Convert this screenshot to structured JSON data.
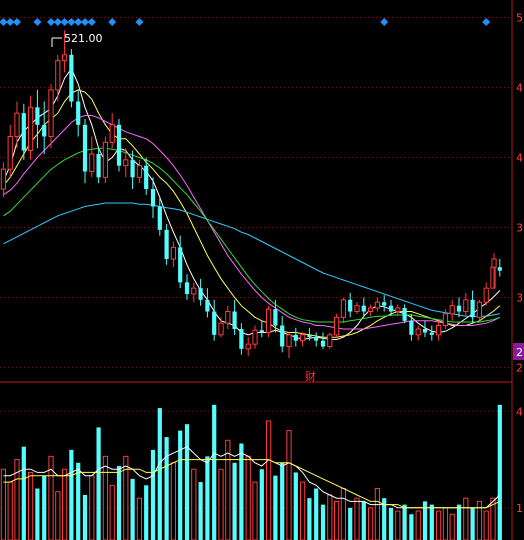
{
  "colors": {
    "background": "#000000",
    "up": "#ff3b3b",
    "down": "#54fcfc",
    "grid": "#7a1010",
    "axis": "#b01818",
    "ma5": "#ffffff",
    "ma10": "#ffff55",
    "ma20": "#ff66ff",
    "ma30": "#33dd33",
    "ma60": "#33ccff",
    "marker": "#1e90ff",
    "peak_label": "#ffffff",
    "event_badge": "#ff3030",
    "side_tag": "#8a1b9c"
  },
  "price_axis_labels": [
    "5",
    "4",
    "4",
    "3",
    "3",
    "2"
  ],
  "volume_axis_labels": [
    "4",
    "1"
  ],
  "peak_label": "521.00",
  "event_badge_text": "财",
  "side_tag_text": "2",
  "chart_data": [
    {
      "type": "candlestick",
      "title": "",
      "ylim": [
        223,
        535
      ],
      "ytick_positions": [
        532,
        472,
        412,
        352,
        292,
        232
      ],
      "ytick_labels": [
        "5",
        "4",
        "4",
        "3",
        "3",
        "2"
      ],
      "highest": 521.0,
      "ohlc": [
        [
          385,
          408,
          378,
          402
        ],
        [
          402,
          440,
          395,
          430
        ],
        [
          430,
          460,
          420,
          450
        ],
        [
          450,
          458,
          410,
          418
        ],
        [
          418,
          465,
          410,
          455
        ],
        [
          455,
          470,
          420,
          440
        ],
        [
          440,
          460,
          415,
          430
        ],
        [
          430,
          475,
          420,
          470
        ],
        [
          470,
          500,
          460,
          495
        ],
        [
          495,
          521,
          485,
          500
        ],
        [
          500,
          505,
          455,
          460
        ],
        [
          460,
          470,
          430,
          440
        ],
        [
          440,
          445,
          390,
          400
        ],
        [
          400,
          430,
          395,
          415
        ],
        [
          415,
          420,
          390,
          395
        ],
        [
          395,
          430,
          390,
          425
        ],
        [
          425,
          450,
          420,
          440
        ],
        [
          440,
          445,
          400,
          405
        ],
        [
          405,
          420,
          395,
          410
        ],
        [
          410,
          418,
          385,
          395
        ],
        [
          395,
          410,
          390,
          405
        ],
        [
          405,
          412,
          380,
          385
        ],
        [
          385,
          395,
          360,
          370
        ],
        [
          370,
          378,
          345,
          350
        ],
        [
          350,
          355,
          320,
          325
        ],
        [
          325,
          340,
          318,
          335
        ],
        [
          335,
          345,
          300,
          305
        ],
        [
          305,
          312,
          290,
          295
        ],
        [
          295,
          305,
          288,
          300
        ],
        [
          300,
          308,
          285,
          290
        ],
        [
          290,
          300,
          275,
          280
        ],
        [
          280,
          290,
          255,
          260
        ],
        [
          260,
          275,
          258,
          270
        ],
        [
          270,
          285,
          265,
          280
        ],
        [
          280,
          290,
          260,
          265
        ],
        [
          265,
          270,
          243,
          248
        ],
        [
          248,
          258,
          242,
          252
        ],
        [
          252,
          268,
          248,
          264
        ],
        [
          264,
          272,
          258,
          262
        ],
        [
          262,
          285,
          258,
          282
        ],
        [
          282,
          290,
          262,
          268
        ],
        [
          268,
          276,
          245,
          250
        ],
        [
          250,
          262,
          240,
          260
        ],
        [
          260,
          266,
          250,
          255
        ],
        [
          255,
          262,
          250,
          260
        ],
        [
          260,
          266,
          255,
          258
        ],
        [
          258,
          262,
          250,
          255
        ],
        [
          255,
          262,
          248,
          250
        ],
        [
          250,
          262,
          248,
          260
        ],
        [
          260,
          278,
          258,
          275
        ],
        [
          275,
          292,
          270,
          290
        ],
        [
          290,
          296,
          275,
          280
        ],
        [
          280,
          288,
          278,
          285
        ],
        [
          285,
          292,
          275,
          280
        ],
        [
          280,
          286,
          276,
          283
        ],
        [
          283,
          292,
          280,
          288
        ],
        [
          288,
          294,
          280,
          285
        ],
        [
          285,
          290,
          276,
          280
        ],
        [
          280,
          286,
          276,
          283
        ],
        [
          283,
          286,
          270,
          272
        ],
        [
          272,
          278,
          255,
          260
        ],
        [
          260,
          268,
          255,
          265
        ],
        [
          265,
          272,
          258,
          262
        ],
        [
          262,
          268,
          255,
          260
        ],
        [
          260,
          272,
          255,
          268
        ],
        [
          268,
          282,
          265,
          278
        ],
        [
          278,
          290,
          272,
          285
        ],
        [
          285,
          292,
          275,
          280
        ],
        [
          280,
          296,
          276,
          290
        ],
        [
          290,
          298,
          270,
          275
        ],
        [
          275,
          290,
          272,
          288
        ],
        [
          288,
          305,
          285,
          300
        ],
        [
          300,
          322,
          300,
          318
        ],
        [
          318,
          325,
          310,
          315
        ]
      ],
      "series": [
        {
          "name": "MA5",
          "values": [
            392,
            405,
            425,
            435,
            440,
            446,
            450,
            454,
            465,
            480,
            488,
            475,
            455,
            440,
            420,
            408,
            412,
            420,
            418,
            410,
            405,
            400,
            392,
            378,
            362,
            348,
            335,
            320,
            308,
            298,
            290,
            280,
            272,
            270,
            268,
            262,
            260,
            262,
            262,
            262,
            264,
            262,
            260,
            258,
            256,
            257,
            258,
            257,
            256,
            256,
            258,
            262,
            268,
            276,
            282,
            285,
            284,
            282,
            280,
            278,
            275,
            270,
            266,
            263,
            262,
            263,
            266,
            270,
            274,
            278,
            283,
            287,
            292,
            298
          ]
        },
        {
          "name": "MA10",
          "values": [
            388,
            395,
            405,
            415,
            425,
            432,
            440,
            445,
            450,
            460,
            467,
            470,
            468,
            462,
            450,
            440,
            432,
            428,
            428,
            422,
            415,
            408,
            402,
            395,
            390,
            383,
            374,
            364,
            352,
            340,
            328,
            318,
            308,
            300,
            292,
            285,
            280,
            275,
            272,
            270,
            266,
            263,
            262,
            262,
            261,
            260,
            259,
            258,
            258,
            258,
            259,
            260,
            262,
            265,
            268,
            272,
            275,
            278,
            280,
            280,
            280,
            278,
            276,
            274,
            272,
            270,
            268,
            268,
            268,
            270,
            272,
            276,
            280,
            285
          ]
        },
        {
          "name": "MA20",
          "values": [
            380,
            384,
            390,
            398,
            405,
            412,
            418,
            424,
            430,
            436,
            442,
            446,
            448,
            448,
            446,
            443,
            440,
            437,
            434,
            432,
            430,
            428,
            424,
            418,
            412,
            405,
            397,
            388,
            378,
            368,
            358,
            348,
            338,
            328,
            320,
            312,
            305,
            298,
            292,
            287,
            283,
            279,
            275,
            273,
            271,
            270,
            268,
            268,
            267,
            266,
            265,
            265,
            265,
            265,
            266,
            267,
            268,
            269,
            270,
            271,
            272,
            272,
            272,
            272,
            271,
            270,
            269,
            268,
            268,
            268,
            269,
            270,
            272,
            275
          ]
        },
        {
          "name": "MA30",
          "values": [
            362,
            366,
            372,
            378,
            384,
            390,
            396,
            402,
            406,
            410,
            413,
            416,
            418,
            419,
            420,
            420,
            419,
            418,
            416,
            414,
            412,
            410,
            407,
            403,
            398,
            392,
            386,
            380,
            373,
            366,
            358,
            350,
            342,
            334,
            326,
            318,
            310,
            303,
            297,
            291,
            286,
            282,
            278,
            275,
            273,
            272,
            271,
            271,
            271,
            271,
            271,
            272,
            273,
            274,
            275,
            276,
            276,
            277,
            277,
            277,
            277,
            276,
            275,
            274,
            273,
            272,
            271,
            271,
            271,
            271,
            271,
            272,
            273,
            275
          ]
        },
        {
          "name": "MA60",
          "values": [
            338,
            341,
            344,
            347,
            350,
            353,
            356,
            359,
            362,
            364,
            366,
            368,
            370,
            371,
            372,
            373,
            373,
            373,
            373,
            373,
            372,
            372,
            371,
            370,
            369,
            368,
            367,
            365,
            363,
            361,
            359,
            357,
            355,
            353,
            351,
            348,
            346,
            343,
            340,
            337,
            334,
            331,
            328,
            325,
            322,
            319,
            316,
            313,
            311,
            309,
            307,
            305,
            303,
            301,
            299,
            297,
            295,
            293,
            291,
            289,
            287,
            285,
            283,
            281,
            280,
            279,
            278,
            277,
            276,
            276,
            276,
            276,
            277,
            278
          ]
        }
      ],
      "gap_candle": [
        318,
        330,
        300,
        325
      ]
    },
    {
      "type": "bar",
      "title": "",
      "ylim": [
        0,
        4.6
      ],
      "ytick_positions": [
        4,
        1
      ],
      "ytick_labels": [
        "4",
        "1"
      ],
      "values": [
        2.2,
        1.8,
        2.5,
        2.9,
        2.1,
        1.6,
        2.0,
        2.6,
        1.5,
        2.2,
        2.8,
        2.4,
        1.4,
        2.0,
        3.5,
        2.6,
        1.7,
        2.3,
        2.6,
        1.9,
        1.3,
        1.7,
        2.8,
        4.1,
        3.2,
        2.4,
        3.4,
        3.6,
        2.2,
        1.8,
        2.6,
        4.2,
        2.2,
        3.1,
        2.4,
        3.0,
        2.6,
        1.8,
        2.2,
        3.7,
        2.0,
        2.4,
        3.4,
        2.1,
        1.8,
        1.3,
        1.6,
        1.1,
        1.4,
        1.2,
        1.6,
        1.0,
        1.3,
        1.2,
        1.0,
        1.6,
        1.3,
        1.0,
        0.9,
        1.1,
        0.8,
        0.9,
        1.2,
        1.1,
        0.9,
        1.0,
        0.8,
        1.1,
        1.3,
        1.0,
        1.2,
        0.9,
        1.3,
        4.2
      ],
      "ma_a": [
        2.0,
        2.0,
        2.1,
        2.2,
        2.2,
        2.1,
        2.1,
        2.2,
        2.0,
        2.0,
        2.1,
        2.2,
        2.0,
        2.0,
        2.2,
        2.3,
        2.2,
        2.2,
        2.3,
        2.2,
        2.0,
        1.9,
        2.0,
        2.4,
        2.6,
        2.7,
        2.8,
        2.9,
        2.7,
        2.5,
        2.4,
        2.7,
        2.6,
        2.7,
        2.6,
        2.7,
        2.6,
        2.4,
        2.3,
        2.5,
        2.4,
        2.3,
        2.4,
        2.3,
        2.1,
        1.8,
        1.7,
        1.5,
        1.4,
        1.3,
        1.3,
        1.2,
        1.2,
        1.2,
        1.1,
        1.1,
        1.1,
        1.1,
        1.0,
        1.0,
        1.0,
        1.0,
        1.0,
        1.0,
        1.0,
        1.0,
        1.0,
        1.0,
        1.0,
        1.0,
        1.0,
        1.0,
        1.2,
        1.4
      ],
      "ma_b": [
        1.8,
        1.8,
        1.9,
        1.9,
        2.0,
        2.0,
        2.0,
        2.0,
        2.0,
        2.0,
        2.0,
        2.1,
        2.1,
        2.1,
        2.1,
        2.1,
        2.1,
        2.1,
        2.2,
        2.2,
        2.2,
        2.1,
        2.1,
        2.2,
        2.3,
        2.4,
        2.5,
        2.5,
        2.5,
        2.5,
        2.5,
        2.5,
        2.5,
        2.5,
        2.5,
        2.5,
        2.5,
        2.5,
        2.5,
        2.5,
        2.4,
        2.4,
        2.4,
        2.3,
        2.2,
        2.1,
        2.0,
        1.9,
        1.8,
        1.7,
        1.6,
        1.5,
        1.4,
        1.3,
        1.2,
        1.2,
        1.1,
        1.1,
        1.1,
        1.0,
        1.0,
        1.0,
        1.0,
        1.0,
        1.0,
        1.0,
        1.0,
        1.0,
        1.0,
        1.0,
        1.0,
        1.0,
        1.1,
        1.2
      ]
    }
  ],
  "markers": {
    "top_diamonds_candle_index": [
      0,
      1,
      2,
      5,
      7,
      8,
      9,
      10,
      11,
      12,
      13,
      16,
      20,
      56,
      71
    ]
  }
}
